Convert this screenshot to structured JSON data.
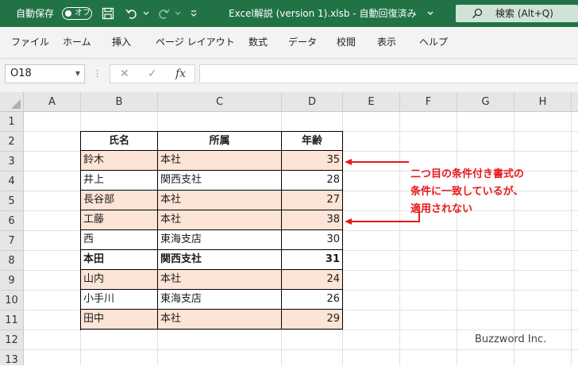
{
  "titlebar": {
    "autosave_label": "自動保存",
    "autosave_state": "オフ",
    "document_title": "Excel解説 (version 1).xlsb  -  自動回復済み",
    "search_label": "検索 (Alt+Q)",
    "accent_color": "#217346"
  },
  "ribbon": {
    "tabs": [
      "ファイル",
      "ホーム",
      "挿入",
      "ページ レイアウト",
      "数式",
      "データ",
      "校閲",
      "表示",
      "ヘルプ"
    ]
  },
  "formula_bar": {
    "name_box": "O18",
    "fx_label": "fx",
    "formula": ""
  },
  "sheet": {
    "columns": [
      "A",
      "B",
      "C",
      "D",
      "E",
      "F",
      "G",
      "H"
    ],
    "rows": [
      "1",
      "2",
      "3",
      "4",
      "5",
      "6",
      "7",
      "8",
      "9",
      "10",
      "11",
      "12",
      "13"
    ],
    "table": {
      "headers": [
        "氏名",
        "所属",
        "年齢"
      ],
      "records": [
        {
          "name": "鈴木",
          "dept": "本社",
          "age": "35",
          "highlight": true,
          "bold": false
        },
        {
          "name": "井上",
          "dept": "関西支社",
          "age": "28",
          "highlight": false,
          "bold": false
        },
        {
          "name": "長谷部",
          "dept": "本社",
          "age": "27",
          "highlight": true,
          "bold": false
        },
        {
          "name": "工藤",
          "dept": "本社",
          "age": "38",
          "highlight": true,
          "bold": false
        },
        {
          "name": "西",
          "dept": "東海支店",
          "age": "30",
          "highlight": false,
          "bold": false
        },
        {
          "name": "本田",
          "dept": "関西支社",
          "age": "31",
          "highlight": false,
          "bold": true
        },
        {
          "name": "山内",
          "dept": "本社",
          "age": "24",
          "highlight": true,
          "bold": false
        },
        {
          "name": "小手川",
          "dept": "東海支店",
          "age": "26",
          "highlight": false,
          "bold": false
        },
        {
          "name": "田中",
          "dept": "本社",
          "age": "29",
          "highlight": true,
          "bold": false
        }
      ],
      "highlight_color": "#fce4d6"
    }
  },
  "annotation": {
    "lines": [
      "二つ目の条件付き書式の",
      "条件に一致しているが、",
      "適用されない"
    ],
    "color": "#e8181c"
  },
  "watermark": "Buzzword Inc."
}
